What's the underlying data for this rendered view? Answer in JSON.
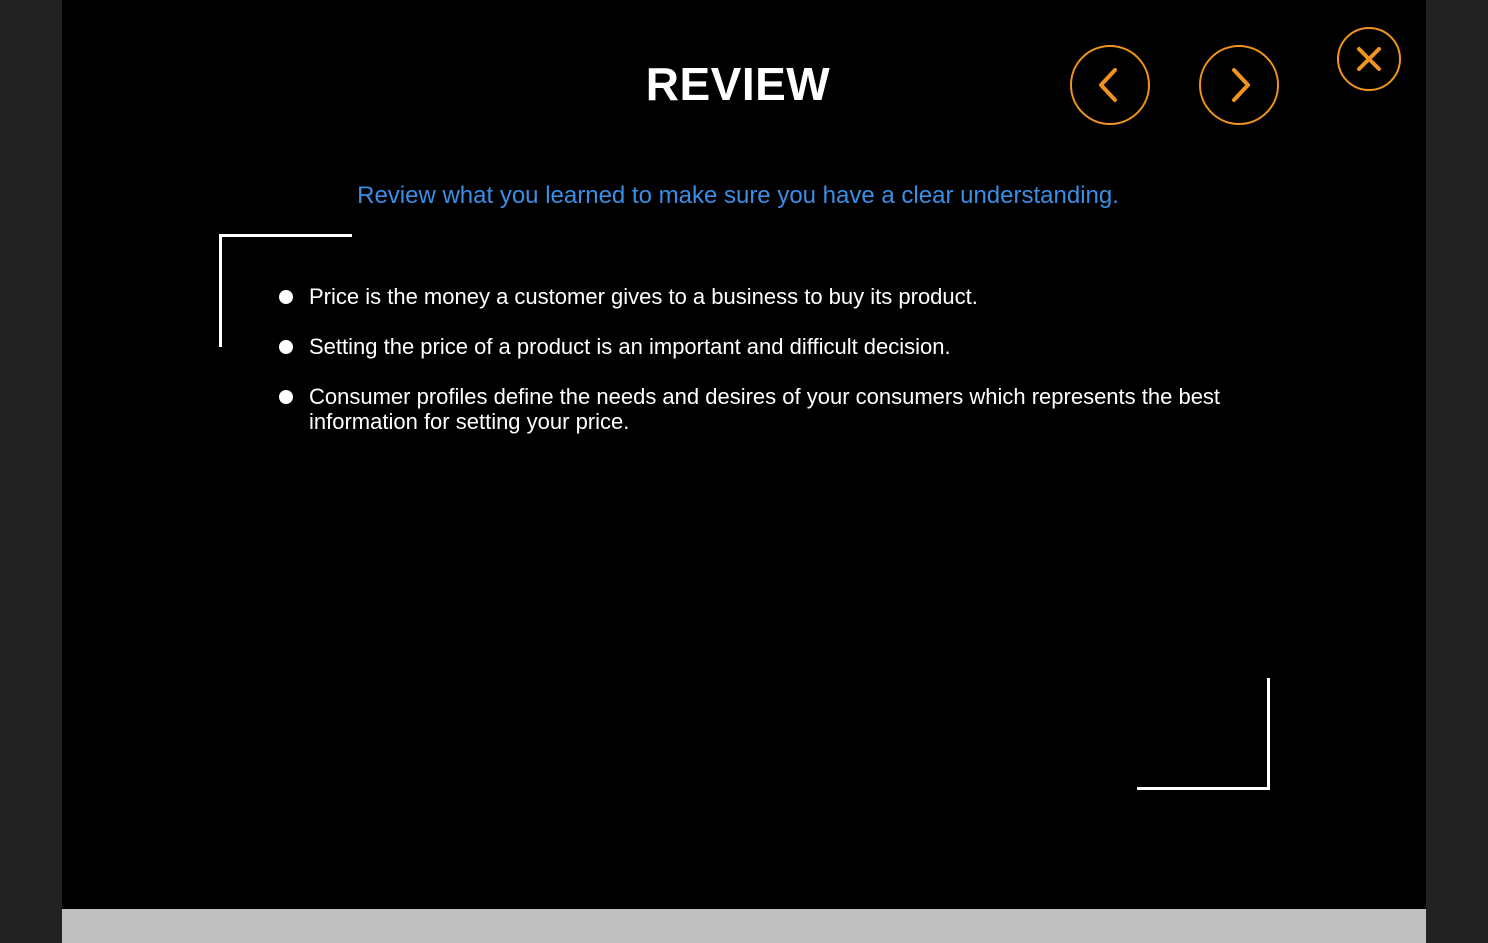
{
  "slide": {
    "title": "REVIEW",
    "subtitle": "Review what you learned to make sure you have a clear understanding.",
    "bullets": [
      "Price is the money a customer gives to a business to buy its product.",
      "Setting the price of a product is an important and difficult decision.",
      "Consumer profiles define the needs and desires of your consumers which represents the best information for setting your price."
    ]
  },
  "controls": {
    "prev_icon": "chevron-left-icon",
    "next_icon": "chevron-right-icon",
    "close_icon": "close-icon"
  },
  "colors": {
    "background": "#000000",
    "accent": "#f0941e",
    "subtitle": "#3a8ee6",
    "text": "#ffffff",
    "bottom_bar": "#c0c0c0"
  }
}
